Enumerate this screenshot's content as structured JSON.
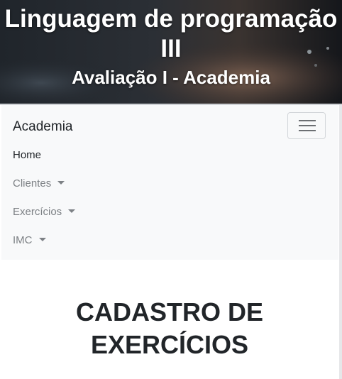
{
  "header": {
    "title": "Linguagem de programação III",
    "subtitle": "Avaliação I - Academia"
  },
  "navbar": {
    "brand": "Academia",
    "toggler_icon": "hamburger-menu-icon",
    "items": [
      {
        "label": "Home",
        "active": true,
        "dropdown": false
      },
      {
        "label": "Clientes",
        "active": false,
        "dropdown": true
      },
      {
        "label": "Exercícios",
        "active": false,
        "dropdown": true
      },
      {
        "label": "IMC",
        "active": false,
        "dropdown": true
      }
    ]
  },
  "main": {
    "heading": "CADASTRO DE EXERCÍCIOS"
  }
}
